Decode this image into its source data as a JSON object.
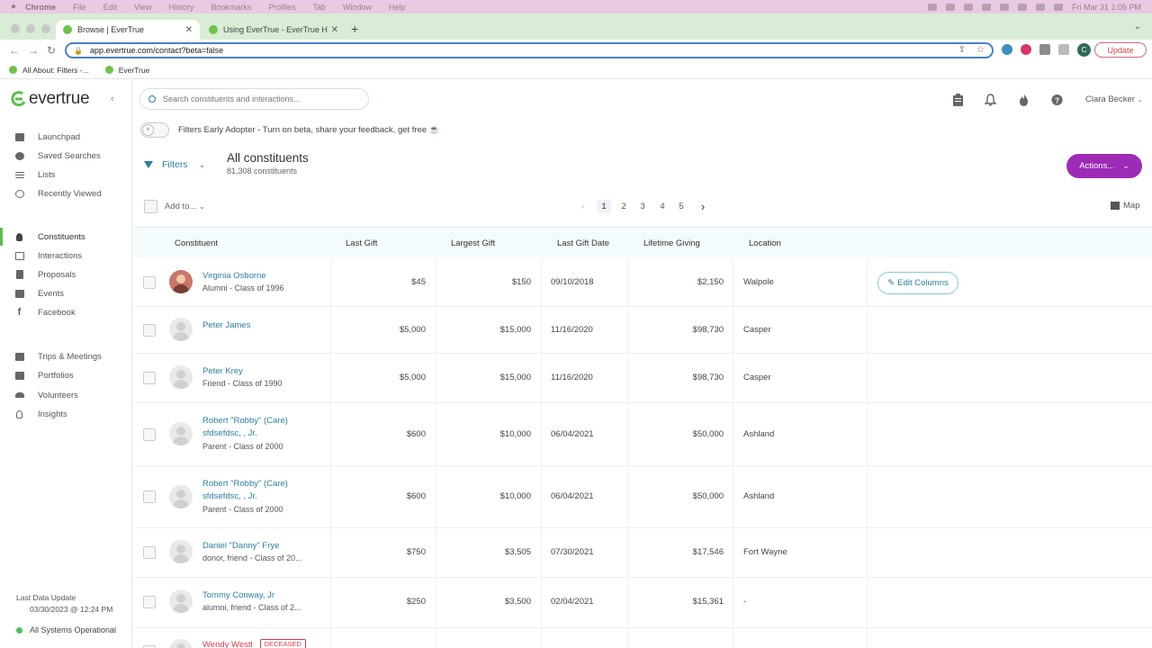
{
  "os_menubar": {
    "app": "Chrome",
    "items": [
      "File",
      "Edit",
      "View",
      "History",
      "Bookmarks",
      "Profiles",
      "Tab",
      "Window",
      "Help"
    ],
    "clock": "Fri Mar 31  1:05 PM"
  },
  "browser": {
    "tabs": [
      {
        "title": "Browse | EverTrue",
        "active": true
      },
      {
        "title": "Using EverTrue - EverTrue Help",
        "active": false
      }
    ],
    "url": "app.evertrue.com/contact?beta=false",
    "update_label": "Update",
    "profile_initial": "C",
    "bookmarks": [
      "All About: Filters -...",
      "EverTrue"
    ]
  },
  "sidebar": {
    "logo_text": "evertrue",
    "groups": [
      [
        {
          "label": "Launchpad",
          "icon": "dashboard-icon"
        },
        {
          "label": "Saved Searches",
          "icon": "pie-chart-icon"
        },
        {
          "label": "Lists",
          "icon": "list-icon"
        },
        {
          "label": "Recently Viewed",
          "icon": "history-icon"
        }
      ],
      [
        {
          "label": "Constituents",
          "icon": "person-icon",
          "active": true
        },
        {
          "label": "Interactions",
          "icon": "edit-icon"
        },
        {
          "label": "Proposals",
          "icon": "document-icon"
        },
        {
          "label": "Events",
          "icon": "calendar-icon"
        },
        {
          "label": "Facebook",
          "icon": "facebook-icon"
        }
      ],
      [
        {
          "label": "Trips & Meetings",
          "icon": "calendar-icon"
        },
        {
          "label": "Portfolios",
          "icon": "portfolio-icon"
        },
        {
          "label": "Volunteers",
          "icon": "group-icon"
        },
        {
          "label": "Insights",
          "icon": "lightbulb-icon"
        }
      ]
    ],
    "last_data_label": "Last Data Update",
    "last_data_value": "03/30/2023 @ 12:24 PM",
    "status_text": "All Systems Operational"
  },
  "header": {
    "search_placeholder": "Search constituents and interactions...",
    "user_name": "Clara Becker",
    "beta_text": "Filters Early Adopter - Turn on beta, share your feedback, get free ☕"
  },
  "list": {
    "filters_label": "Filters",
    "title": "All constituents",
    "count": "81,308 constituents",
    "actions_label": "Actions...",
    "add_to_label": "Add to...",
    "pages": [
      "1",
      "2",
      "3",
      "4",
      "5"
    ],
    "current_page": "1",
    "map_label": "Map",
    "edit_columns_label": "Edit Columns"
  },
  "table": {
    "columns": [
      "Constituent",
      "Last Gift",
      "Largest Gift",
      "Last Gift Date",
      "Lifetime Giving",
      "Location"
    ],
    "rows": [
      {
        "name": [
          "Virginia Osborne"
        ],
        "sub": "Alumni - Class of 1996",
        "last_gift": "$45",
        "largest_gift": "$150",
        "last_gift_date": "09/10/2018",
        "lifetime": "$2,150",
        "location": "Walpole",
        "photo": true
      },
      {
        "name": [
          "Peter James"
        ],
        "sub": "",
        "last_gift": "$5,000",
        "largest_gift": "$15,000",
        "last_gift_date": "11/16/2020",
        "lifetime": "$98,730",
        "location": "Casper"
      },
      {
        "name": [
          "Peter Krey"
        ],
        "sub": "Friend - Class of 1990",
        "last_gift": "$5,000",
        "largest_gift": "$15,000",
        "last_gift_date": "11/16/2020",
        "lifetime": "$98,730",
        "location": "Casper"
      },
      {
        "name": [
          "Robert \"Robby\" (Care)",
          "sfdsefdsc, , Jr."
        ],
        "sub": "Parent - Class of 2000",
        "last_gift": "$600",
        "largest_gift": "$10,000",
        "last_gift_date": "06/04/2021",
        "lifetime": "$50,000",
        "location": "Ashland"
      },
      {
        "name": [
          "Robert \"Robby\" (Care)",
          "sfdsefdsc, , Jr."
        ],
        "sub": "Parent - Class of 2000",
        "last_gift": "$600",
        "largest_gift": "$10,000",
        "last_gift_date": "06/04/2021",
        "lifetime": "$50,000",
        "location": "Ashland"
      },
      {
        "name": [
          "Daniel \"Danny\" Frye"
        ],
        "sub": "donor, friend - Class of 20...",
        "last_gift": "$750",
        "largest_gift": "$3,505",
        "last_gift_date": "07/30/2021",
        "lifetime": "$17,546",
        "location": "Fort Wayne"
      },
      {
        "name": [
          "Tommy Conway, Jr"
        ],
        "sub": "alumni, friend - Class of 2...",
        "last_gift": "$250",
        "largest_gift": "$3,500",
        "last_gift_date": "02/04/2021",
        "lifetime": "$15,361",
        "location": "-"
      },
      {
        "name": [
          "Wendy Westl"
        ],
        "sub": "",
        "badge": "DECEASED",
        "last_gift": "",
        "largest_gift": "",
        "last_gift_date": "",
        "lifetime": "",
        "location": ""
      }
    ]
  },
  "colors": {
    "accent_purple": "#9d2bb5",
    "link_blue": "#2c7da0",
    "brand_green": "#5bbf4b",
    "deceased_red": "#d63b4a"
  }
}
